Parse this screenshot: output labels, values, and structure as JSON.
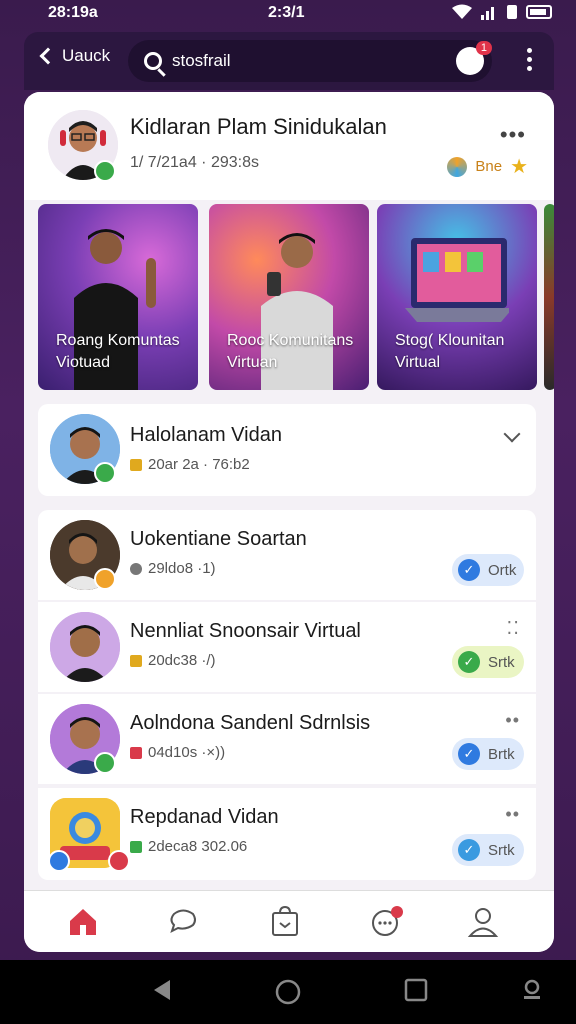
{
  "status_bar": {
    "time": "28:19a",
    "center": "2:3/1"
  },
  "app_bar": {
    "back_label": "Uauck",
    "search_value": "stosfrail",
    "notification_count": "1"
  },
  "profile": {
    "name": "Kidlaran Plam Sinidukalan",
    "meta": "1/ 7/21a4 · 293:8s",
    "chip_label": "Bne"
  },
  "banners": [
    {
      "caption_line1": "Roang Komuntas",
      "caption_line2": "Viotuad"
    },
    {
      "caption_line1": "Rooc Komunitans",
      "caption_line2": "Virtuan"
    },
    {
      "caption_line1": "Stog( Klounitan",
      "caption_line2": "Virtual"
    }
  ],
  "featured_item": {
    "title": "Halolanam Vidan",
    "meta": "20ar 2a · 76:b2"
  },
  "list_items": [
    {
      "title": "Uokentiane Soartan",
      "meta": "29ldo8 ·1)",
      "status": "Ortk"
    },
    {
      "title": "Nennliat Snoonsair Virtual",
      "meta": "20dc38 ·/)",
      "status": "Srtk"
    },
    {
      "title": "Aolndona Sandenl Sdrnlsis",
      "meta": "04d10s ·×))",
      "status": "Brtk"
    },
    {
      "title": "Repdanad Vidan",
      "meta": "2deca8 302.06",
      "status": "Srtk"
    }
  ],
  "colors": {
    "accent": "#d93a4a",
    "background": "#3a1b4d"
  }
}
